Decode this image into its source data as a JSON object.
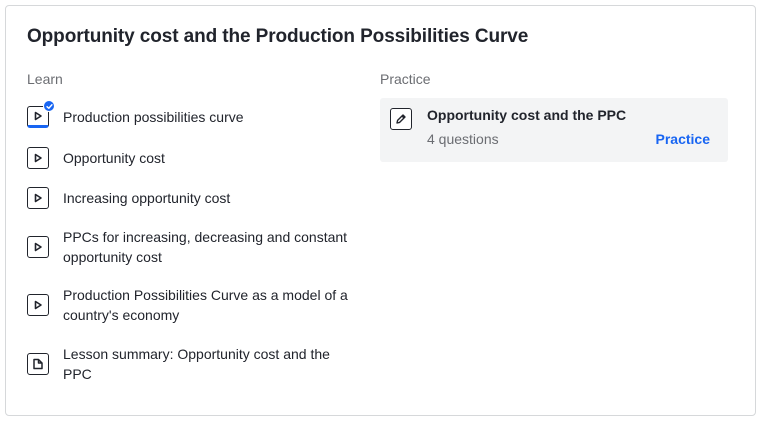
{
  "unit": {
    "title": "Opportunity cost and the Production Possibilities Curve"
  },
  "learn": {
    "heading": "Learn",
    "items": [
      {
        "label": "Production possibilities curve",
        "icon": "video-icon",
        "status": "completed"
      },
      {
        "label": "Opportunity cost",
        "icon": "video-icon"
      },
      {
        "label": "Increasing opportunity cost",
        "icon": "video-icon"
      },
      {
        "label": "PPCs for increasing, decreasing and constant opportunity cost",
        "icon": "video-icon"
      },
      {
        "label": "Production Possibilities Curve as a model of a country's economy",
        "icon": "video-icon"
      },
      {
        "label": "Lesson summary: Opportunity cost and the PPC",
        "icon": "article-icon"
      }
    ]
  },
  "practice": {
    "heading": "Practice",
    "exercise": {
      "title": "Opportunity cost and the PPC",
      "questions": "4 questions",
      "action": "Practice",
      "icon": "pencil-icon"
    }
  },
  "colors": {
    "accent": "#1865f2",
    "text": "#21242c",
    "muted": "#6b6d72",
    "practice_bg": "#f3f4f5"
  }
}
